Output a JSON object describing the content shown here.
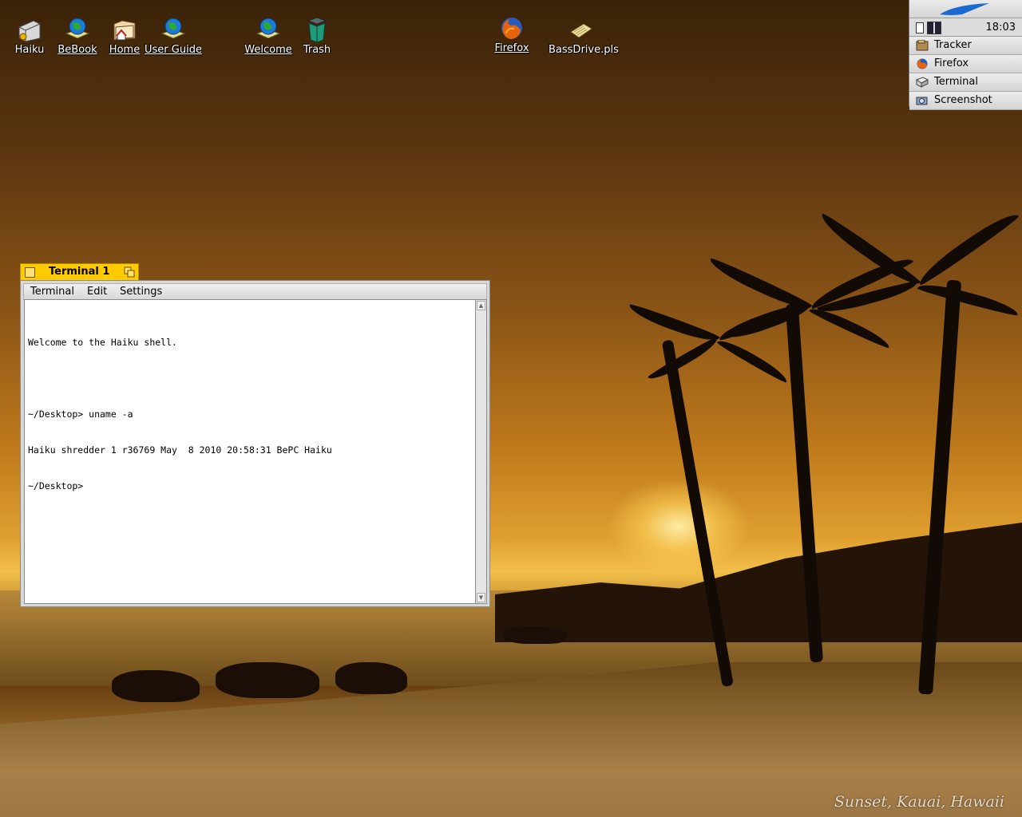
{
  "desktop": {
    "icons": [
      {
        "label": "Haiku",
        "icon": "haiku-volume-icon",
        "link": false
      },
      {
        "label": "BeBook",
        "icon": "bebook-icon",
        "link": true
      },
      {
        "label": "Home",
        "icon": "home-folder-icon",
        "link": true
      },
      {
        "label": "User Guide",
        "icon": "user-guide-icon",
        "link": true
      },
      {
        "label": "Welcome",
        "icon": "welcome-icon",
        "link": true
      },
      {
        "label": "Trash",
        "icon": "trash-icon",
        "link": false
      },
      {
        "label": "Firefox",
        "icon": "firefox-icon",
        "link": true
      },
      {
        "label": "BassDrive.pls",
        "icon": "playlist-file-icon",
        "link": false
      }
    ],
    "wallpaper_caption": "Sunset, Kauai, Hawaii"
  },
  "deskbar": {
    "clock": "18:03",
    "apps": [
      {
        "label": "Tracker",
        "icon": "tracker-icon"
      },
      {
        "label": "Firefox",
        "icon": "firefox-icon"
      },
      {
        "label": "Terminal",
        "icon": "terminal-icon"
      },
      {
        "label": "Screenshot",
        "icon": "screenshot-icon"
      }
    ]
  },
  "terminal": {
    "title": "Terminal 1",
    "menus": [
      "Terminal",
      "Edit",
      "Settings"
    ],
    "lines": [
      "Welcome to the Haiku shell.",
      "",
      "~/Desktop> uname -a",
      "Haiku shredder 1 r36769 May  8 2010 20:58:31 BePC Haiku",
      "~/Desktop>"
    ]
  },
  "colors": {
    "window_tab": "#ffcb00",
    "panel": "#d8d8d8"
  }
}
